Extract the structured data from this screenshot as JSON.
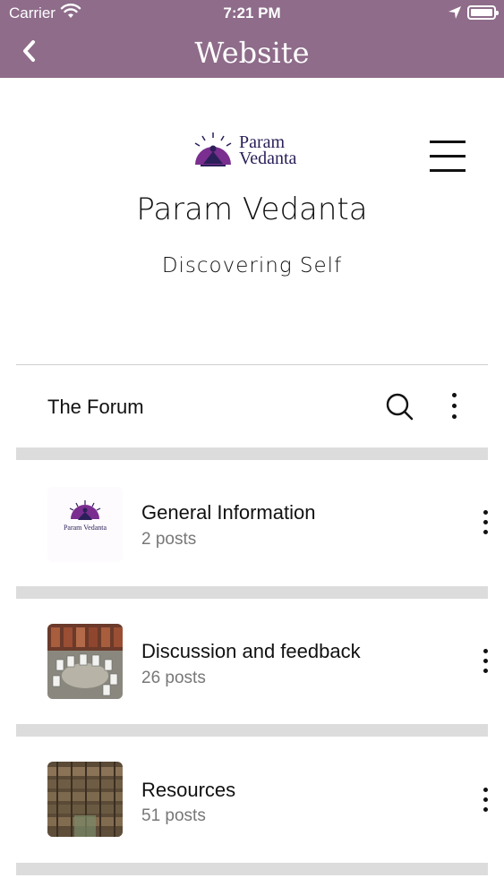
{
  "status_bar": {
    "carrier": "Carrier",
    "time": "7:21 PM",
    "icons": [
      "wifi-icon",
      "location-arrow-icon",
      "battery-icon"
    ]
  },
  "nav": {
    "title": "Website",
    "back_icon": "chevron-left-icon"
  },
  "site": {
    "logo_text_1": "Param",
    "logo_text_2": "Vedanta",
    "title": "Param Vedanta",
    "subtitle": "Discovering Self",
    "menu_icon": "hamburger-icon"
  },
  "forum": {
    "title": "The Forum",
    "search_icon": "search-icon",
    "more_icon": "more-vertical-icon",
    "categories": [
      {
        "title": "General Information",
        "posts": "2 posts",
        "thumb": "param-vedanta-logo"
      },
      {
        "title": "Discussion and feedback",
        "posts": "26 posts",
        "thumb": "circle-of-chairs-photo"
      },
      {
        "title": "Resources",
        "posts": "51 posts",
        "thumb": "library-shelves-photo"
      }
    ]
  },
  "colors": {
    "header_bg": "#8e6c8a",
    "logo_purple": "#7a2e8f",
    "logo_text": "#2b1f59",
    "separator": "#dcdcdc"
  }
}
